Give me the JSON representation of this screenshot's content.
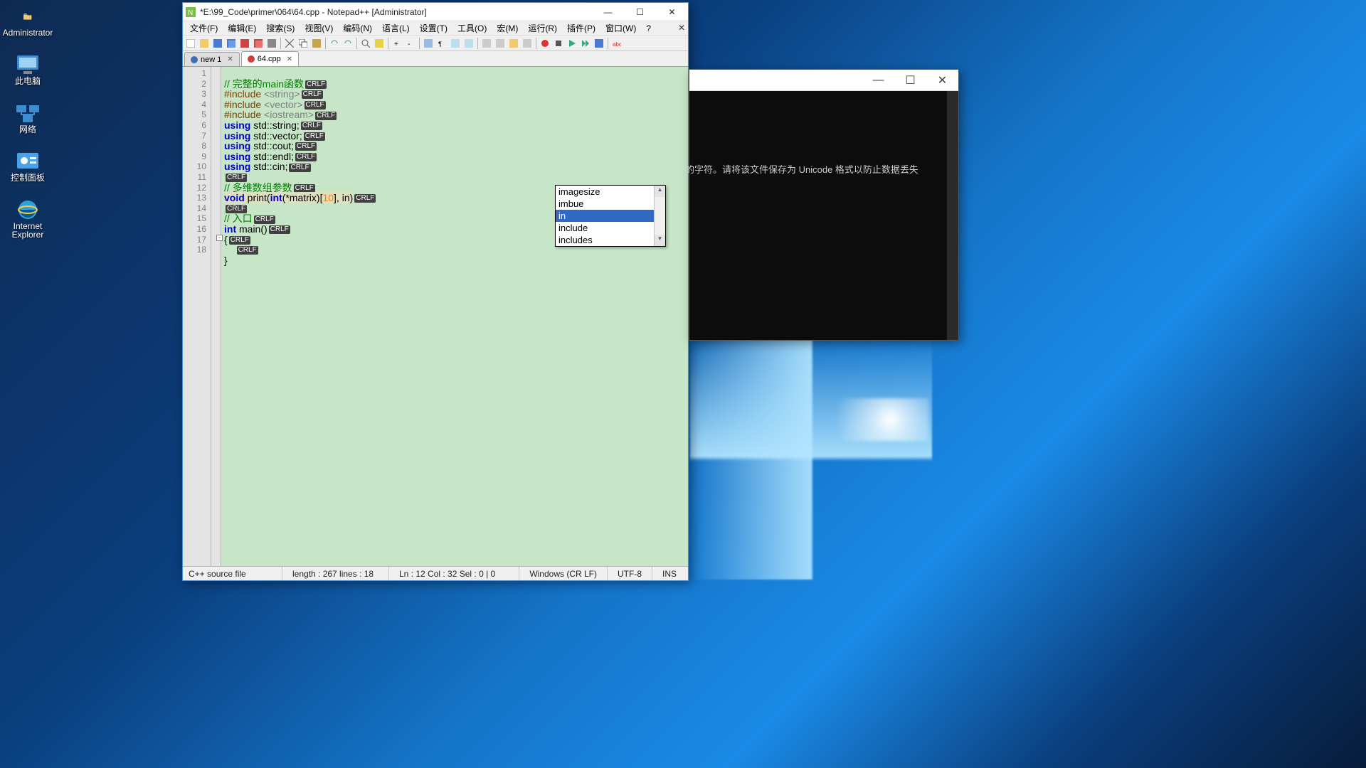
{
  "desktop": {
    "items": [
      {
        "label": "Administrator",
        "icon": "folder-icon",
        "color": "#f2c96b"
      },
      {
        "label": "此电脑",
        "icon": "computer-icon",
        "color": "#4aa2e6"
      },
      {
        "label": "网络",
        "icon": "network-icon",
        "color": "#4aa2e6"
      },
      {
        "label": "控制面板",
        "icon": "control-panel-icon",
        "color": "#49a0dc"
      },
      {
        "label": "Internet Explorer",
        "icon": "ie-icon",
        "color": "#2fa1da"
      }
    ]
  },
  "npp": {
    "title": "*E:\\99_Code\\primer\\064\\64.cpp - Notepad++ [Administrator]",
    "menus": [
      "文件(F)",
      "编辑(E)",
      "搜索(S)",
      "视图(V)",
      "编码(N)",
      "语言(L)",
      "设置(T)",
      "工具(O)",
      "宏(M)",
      "运行(R)",
      "插件(P)",
      "窗口(W)",
      "?"
    ],
    "tabs": [
      {
        "label": "new 1",
        "dirty": false
      },
      {
        "label": "64.cpp",
        "dirty": true
      }
    ],
    "gutter_lines": [
      "1",
      "2",
      "3",
      "4",
      "5",
      "6",
      "7",
      "8",
      "9",
      "10",
      "11",
      "12",
      "13",
      "14",
      "15",
      "16",
      "17",
      "18"
    ],
    "crlf_tag": "CRLF",
    "code": {
      "l1": "// 完整的main函数",
      "l2a": "#include ",
      "l2b": "<string>",
      "l3a": "#include ",
      "l3b": "<vector>",
      "l4a": "#include ",
      "l4b": "<iostream>",
      "l5a": "using",
      "l5b": " std::string;",
      "l6a": "using",
      "l6b": " std::vector;",
      "l7a": "using",
      "l7b": " std::cout;",
      "l8a": "using",
      "l8b": " std::endl;",
      "l9a": "using",
      "l9b": " std::cin;",
      "l11": "// 多维数组参数",
      "l12_void": "void",
      "l12_print": " print(",
      "l12_int1": "int",
      "l12_rest1": "(*matrix)[",
      "l12_num": "10",
      "l12_rest2": "], in)",
      "l14": "// 入口",
      "l15_int": "int",
      "l15_rest": " main()",
      "l16": "{",
      "l18": "}"
    },
    "autocomplete": {
      "items": [
        "imagesize",
        "imbue",
        "in",
        "include",
        "includes"
      ],
      "selected_index": 2
    },
    "status": {
      "filetype": "C++ source file",
      "length": "length : 267    lines : 18",
      "pos": "Ln : 12    Col : 32    Sel : 0 | 0",
      "eol": "Windows (CR LF)",
      "enc": "UTF-8",
      "ins": "INS"
    }
  },
  "console": {
    "message": "的字符。请将该文件保存为 Unicode 格式以防止数据丢失"
  }
}
